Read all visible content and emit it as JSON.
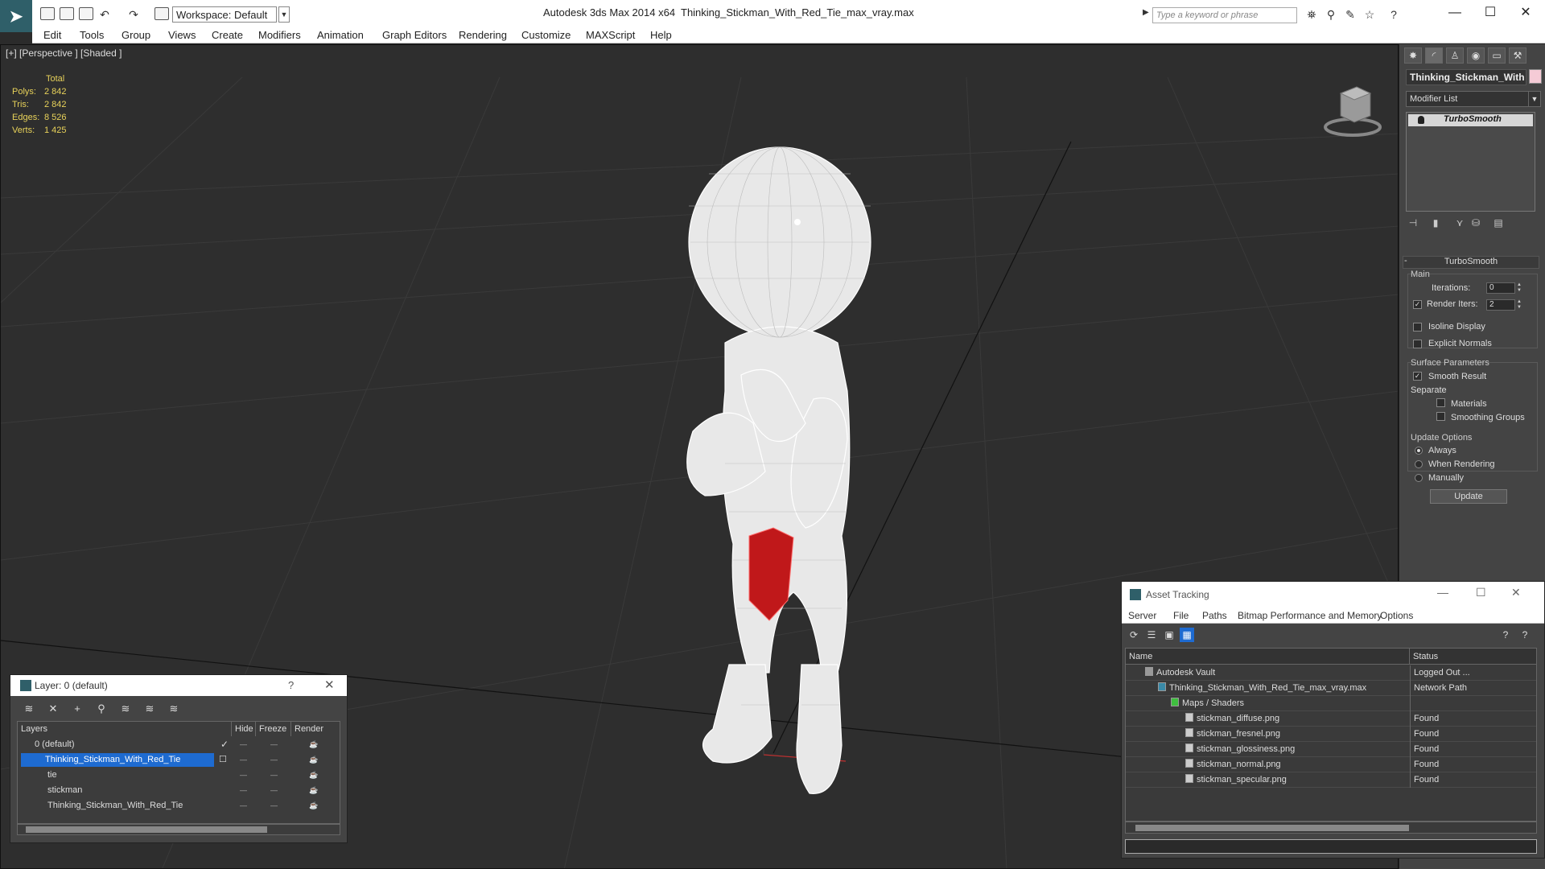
{
  "titlebar": {
    "workspace": "Workspace: Default",
    "app_title": "Autodesk 3ds Max  2014 x64",
    "file_title": "Thinking_Stickman_With_Red_Tie_max_vray.max",
    "search_placeholder": "Type a keyword or phrase"
  },
  "menu": [
    "Edit",
    "Tools",
    "Group",
    "Views",
    "Create",
    "Modifiers",
    "Animation",
    "Graph Editors",
    "Rendering",
    "Customize",
    "MAXScript",
    "Help"
  ],
  "viewport": {
    "label": "[+] [Perspective ] [Shaded ]",
    "stats": {
      "header": "Total",
      "rows": [
        {
          "k": "Polys:",
          "v": "2 842"
        },
        {
          "k": "Tris:",
          "v": "2 842"
        },
        {
          "k": "Edges:",
          "v": "8 526"
        },
        {
          "k": "Verts:",
          "v": "1 425"
        }
      ]
    },
    "tie_color": "#c0181a"
  },
  "command_panel": {
    "object_name": "Thinking_Stickman_With",
    "object_color": "#f5cbd6",
    "modifier_list": "Modifier List",
    "stack_item": "TurboSmooth",
    "rollout_title": "TurboSmooth",
    "main_group": "Main",
    "iterations_label": "Iterations:",
    "iterations_value": "0",
    "render_iters_label": "Render Iters:",
    "render_iters_value": "2",
    "isoline_label": "Isoline Display",
    "explicit_normals_label": "Explicit Normals",
    "surface_group": "Surface Parameters",
    "smooth_result_label": "Smooth Result",
    "separate_label": "Separate",
    "materials_label": "Materials",
    "smoothing_groups_label": "Smoothing Groups",
    "update_group": "Update Options",
    "always_label": "Always",
    "when_rendering_label": "When Rendering",
    "manually_label": "Manually",
    "update_button": "Update"
  },
  "layer_dialog": {
    "title": "Layer: 0 (default)",
    "help": "?",
    "headers": [
      "Layers",
      "Hide",
      "Freeze",
      "Render"
    ],
    "rows": [
      {
        "name": "0 (default)",
        "checked": true
      },
      {
        "name": "Thinking_Stickman_With_Red_Tie",
        "selected": true
      },
      {
        "name": "tie"
      },
      {
        "name": "stickman"
      },
      {
        "name": "Thinking_Stickman_With_Red_Tie"
      }
    ]
  },
  "asset_dialog": {
    "title": "Asset Tracking",
    "menu": [
      "Server",
      "File",
      "Paths",
      "Bitmap Performance and Memory",
      "Options"
    ],
    "headers": [
      "Name",
      "Status"
    ],
    "rows": [
      {
        "name": "Autodesk Vault",
        "status": "Logged Out ..."
      },
      {
        "name": "Thinking_Stickman_With_Red_Tie_max_vray.max",
        "status": "Network Path"
      },
      {
        "name": "Maps / Shaders",
        "status": ""
      },
      {
        "name": "stickman_diffuse.png",
        "status": "Found"
      },
      {
        "name": "stickman_fresnel.png",
        "status": "Found"
      },
      {
        "name": "stickman_glossiness.png",
        "status": "Found"
      },
      {
        "name": "stickman_normal.png",
        "status": "Found"
      },
      {
        "name": "stickman_specular.png",
        "status": "Found"
      }
    ]
  }
}
